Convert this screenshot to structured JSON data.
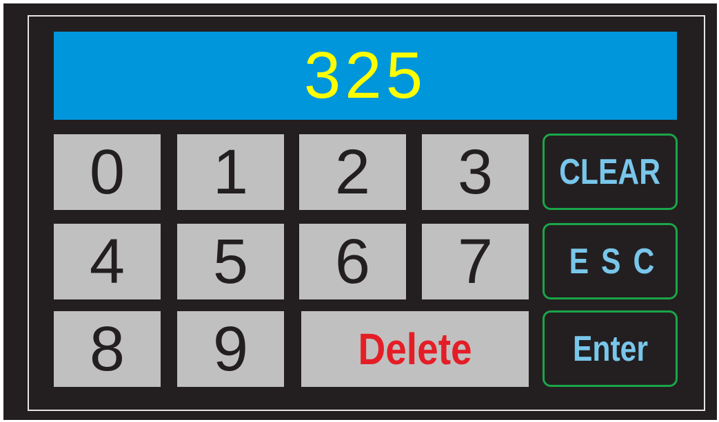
{
  "display": {
    "value": "325"
  },
  "keypad": {
    "digits": [
      "0",
      "1",
      "2",
      "3",
      "4",
      "5",
      "6",
      "7",
      "8",
      "9"
    ],
    "delete_label": "Delete"
  },
  "side_keys": {
    "clear_label": "CLEAR",
    "esc_label": "ESC",
    "enter_label": "Enter"
  },
  "colors": {
    "panel": "#231f20",
    "display_bg": "#0096dc",
    "display_text": "#ffff00",
    "key_bg": "#c0c0c0",
    "delete_text": "#e41e26",
    "side_key_text": "#79c6eb",
    "side_key_border": "#1aa64a"
  }
}
